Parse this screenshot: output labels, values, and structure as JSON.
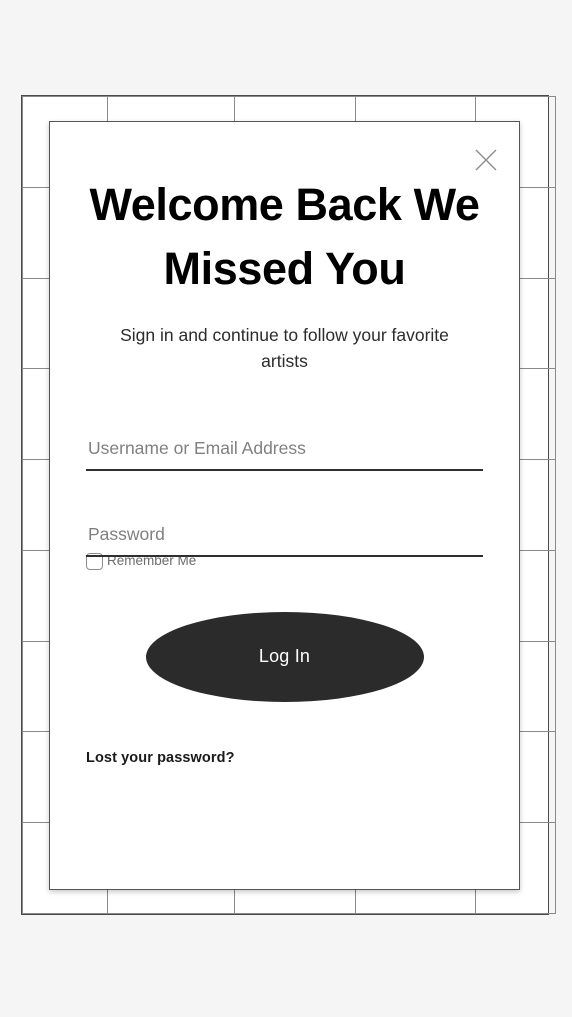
{
  "page": {
    "background_color": "#f5f5f5",
    "grid": {
      "rows": 9,
      "columns": 5,
      "line_color": "#8a8a8a",
      "outer_border_color": "#4a4a4a"
    }
  },
  "modal": {
    "background_color": "#ffffff",
    "border_color": "#555555",
    "close": {
      "icon": "close-icon",
      "label": "Close",
      "color": "#8a8a8a"
    },
    "title": "Welcome Back We Missed You",
    "subtitle": "Sign in and continue to follow your favorite artists",
    "fields": [
      {
        "name": "username",
        "placeholder": "Username or Email Address",
        "value": "",
        "type": "text"
      },
      {
        "name": "password",
        "placeholder": "Password",
        "value": "",
        "type": "password"
      }
    ],
    "remember": {
      "label": "Remember Me",
      "checked": false
    },
    "submit": {
      "label": "Log In",
      "background_color": "#2b2b2b",
      "text_color": "#ffffff"
    },
    "lost_password": {
      "label": "Lost your password?",
      "color": "#1a1a1a"
    }
  }
}
